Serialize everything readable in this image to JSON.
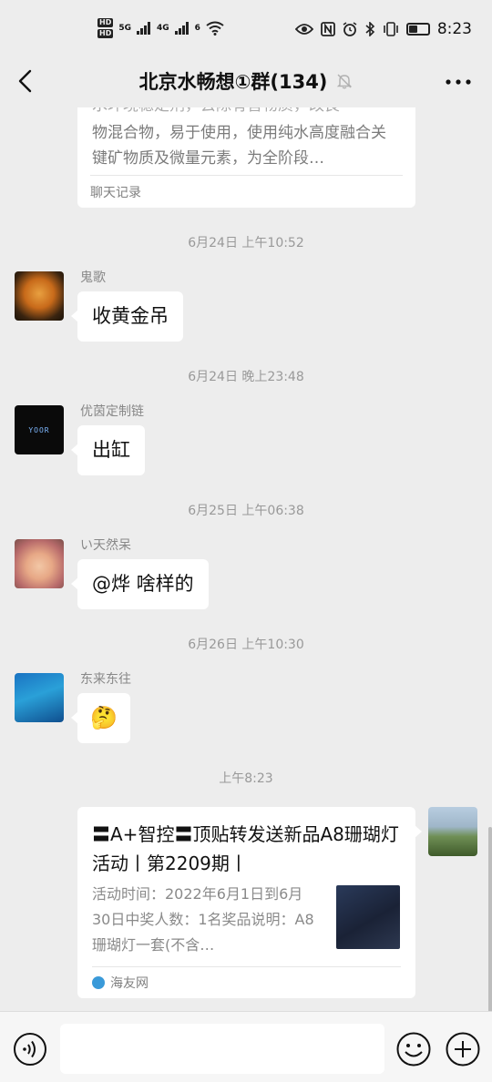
{
  "status_bar": {
    "hd_top": "HD",
    "hd_bottom": "HD",
    "signal1": "5G",
    "signal2": "4G",
    "wifi": "6",
    "time": "8:23",
    "icons": [
      "eye-icon",
      "nfc-icon",
      "alarm-icon",
      "bluetooth-icon",
      "vibrate-icon",
      "battery-icon"
    ]
  },
  "header": {
    "title": "北京水畅想①群(134)",
    "muted": true
  },
  "top_card": {
    "ghost_line": "水环境稳定剂，去除有害物质，改良",
    "description": "物混合物，易于使用，使用纯水高度融合关键矿物质及微量元素，为全阶段…",
    "source": "聊天记录"
  },
  "messages": [
    {
      "time": "6月24日 上午10:52",
      "sender": "鬼歌",
      "text": "收黄金吊",
      "avatar": "tiger-avatar"
    },
    {
      "time": "6月24日 晚上23:48",
      "sender": "优茵定制链",
      "text": "出缸",
      "avatar": "yoor-avatar",
      "avatar_text": "YOOR"
    },
    {
      "time": "6月25日 上午06:38",
      "sender": "い天然呆",
      "text": "@烨  啥样的",
      "avatar": "baby-avatar"
    },
    {
      "time": "6月26日 上午10:30",
      "sender": "东来东往",
      "text": "🤔",
      "avatar": "diver-avatar"
    }
  ],
  "last_time": "上午8:23",
  "share_card": {
    "title": "〓A+智控〓顶贴转发送新品A8珊瑚灯活动丨第2209期丨",
    "description": "活动时间：2022年6月1日到6月30日中奖人数：1名奖品说明：A8珊瑚灯一套(不含…",
    "source": "海友网"
  },
  "input_bar": {
    "placeholder": ""
  },
  "colors": {
    "background": "#ededed",
    "bubble": "#ffffff",
    "muted_text": "#999999"
  }
}
